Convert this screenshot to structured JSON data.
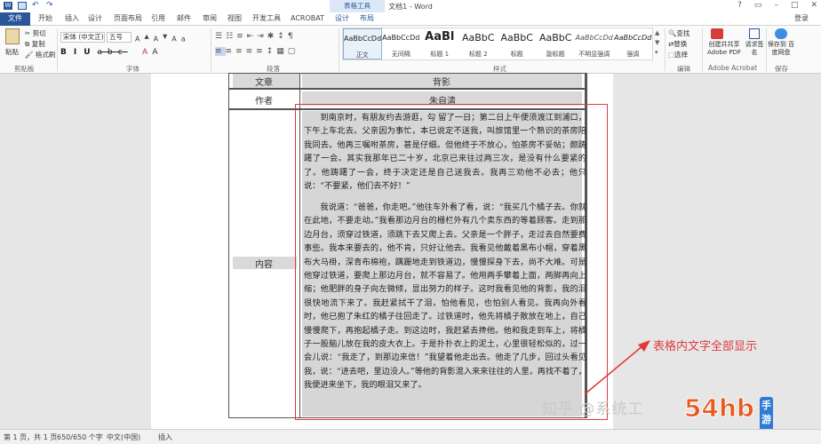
{
  "window": {
    "title": "文档1 - Word",
    "context_tab_group": "表格工具",
    "login": "登录"
  },
  "tabs": [
    "文件",
    "开始",
    "插入",
    "设计",
    "页面布局",
    "引用",
    "邮件",
    "审阅",
    "视图",
    "开发工具",
    "ACROBAT",
    "设计",
    "布局"
  ],
  "ribbon": {
    "clipboard": {
      "paste": "粘贴",
      "cut": "剪切",
      "copy": "复制",
      "format_painter": "格式刷",
      "label": "剪贴板"
    },
    "font": {
      "name": "宋体 (中文正)",
      "size": "五号",
      "label": "字体"
    },
    "paragraph": {
      "label": "段落"
    },
    "styles": {
      "label": "样式",
      "items": [
        {
          "preview": "AaBbCcDd",
          "name": "正文"
        },
        {
          "preview": "AaBbCcDd",
          "name": "无间隔"
        },
        {
          "preview": "AaBl",
          "name": "标题 1"
        },
        {
          "preview": "AaBbC",
          "name": "标题 2"
        },
        {
          "preview": "AaBbC",
          "name": "标题"
        },
        {
          "preview": "AaBbC",
          "name": "副标题"
        },
        {
          "preview": "AaBbCcDd",
          "name": "不明显强调"
        },
        {
          "preview": "AaBbCcDd",
          "name": "强调"
        }
      ]
    },
    "editing": {
      "find": "查找",
      "replace": "替换",
      "select": "选择",
      "label": "编辑"
    },
    "acrobat": {
      "create_share_pdf": "创建并共享 Adobe PDF",
      "request_signature": "请求签名",
      "label": "Adobe Acrobat"
    },
    "save": {
      "save_to_baidu": "保存到 百度网盘",
      "label": "保存"
    }
  },
  "table": {
    "row1": {
      "label": "文章",
      "value": "背影"
    },
    "row2": {
      "label": "作者",
      "value": "朱自清"
    },
    "row3": {
      "label": "内容"
    },
    "paragraphs": [
      "到南京时，有朋友约去游逛，勾 留了一日；第二日上午便须渡江到浦口，下午上车北去。父亲因为事忙，本已说定不送我，叫旅馆里一个熟识的茶房陪我同去。他再三嘱咐茶房，甚是仔细。但他终于不放心，怕茶房不妥帖；颇踌躇了一会。其实我那年已二十岁，北京已来往过两三次，是没有什么要紧的了。他踌躇了一会，终于决定还是自己送我去。我再三劝他不必去；他只说：“不要紧，他们去不好！”",
      "我说道：“爸爸，你走吧。”他往车外看了看，说：“我买几个橘子去。你就在此地，不要走动。”我看那边月台的栅栏外有几个卖东西的等着顾客。走到那边月台，须穿过铁道，须跳下去又爬上去。父亲是一个胖子，走过去自然要费事些。我本来要去的，他不肯，只好让他去。我看见他戴着黑布小帽，穿着黑布大马褂，深青布棉袍，蹒跚地走到铁道边，慢慢探身下去，尚不大难。可是他穿过铁道，要爬上那边月台，就不容易了。他用两手攀着上面，两脚再向上缩；他肥胖的身子向左微倾，显出努力的样子。这时我看见他的背影，我的泪很快地流下来了。我赶紧拭干了泪，怕他看见，也怕别人看见。我再向外看时，他已抱了朱红的橘子往回走了。过铁道时，他先将橘子散放在地上，自己慢慢爬下，再抱起橘子走。到这边时，我赶紧去搀他。他和我走到车上，将橘子一股脑儿放在我的皮大衣上。于是扑扑衣上的泥土，心里很轻松似的，过一会儿说：“我走了，到那边来信！”我望着他走出去。他走了几步，回过头看见我，说：“进去吧，里边没人。”等他的背影混入来来往往的人里，再找不着了，我便进来坐下，我的眼泪又来了。"
    ]
  },
  "annotation": "表格内文字全部显示",
  "watermark": "知乎 @系统工",
  "logo": {
    "big": "54hb",
    "small": "手游网"
  },
  "statusbar": {
    "page": "第 1 页，共 1 页",
    "words": "650/650 个字",
    "language": "中文(中国)",
    "mode": "插入"
  },
  "colors": {
    "accent": "#2b579a",
    "annotation": "#e0393e"
  }
}
